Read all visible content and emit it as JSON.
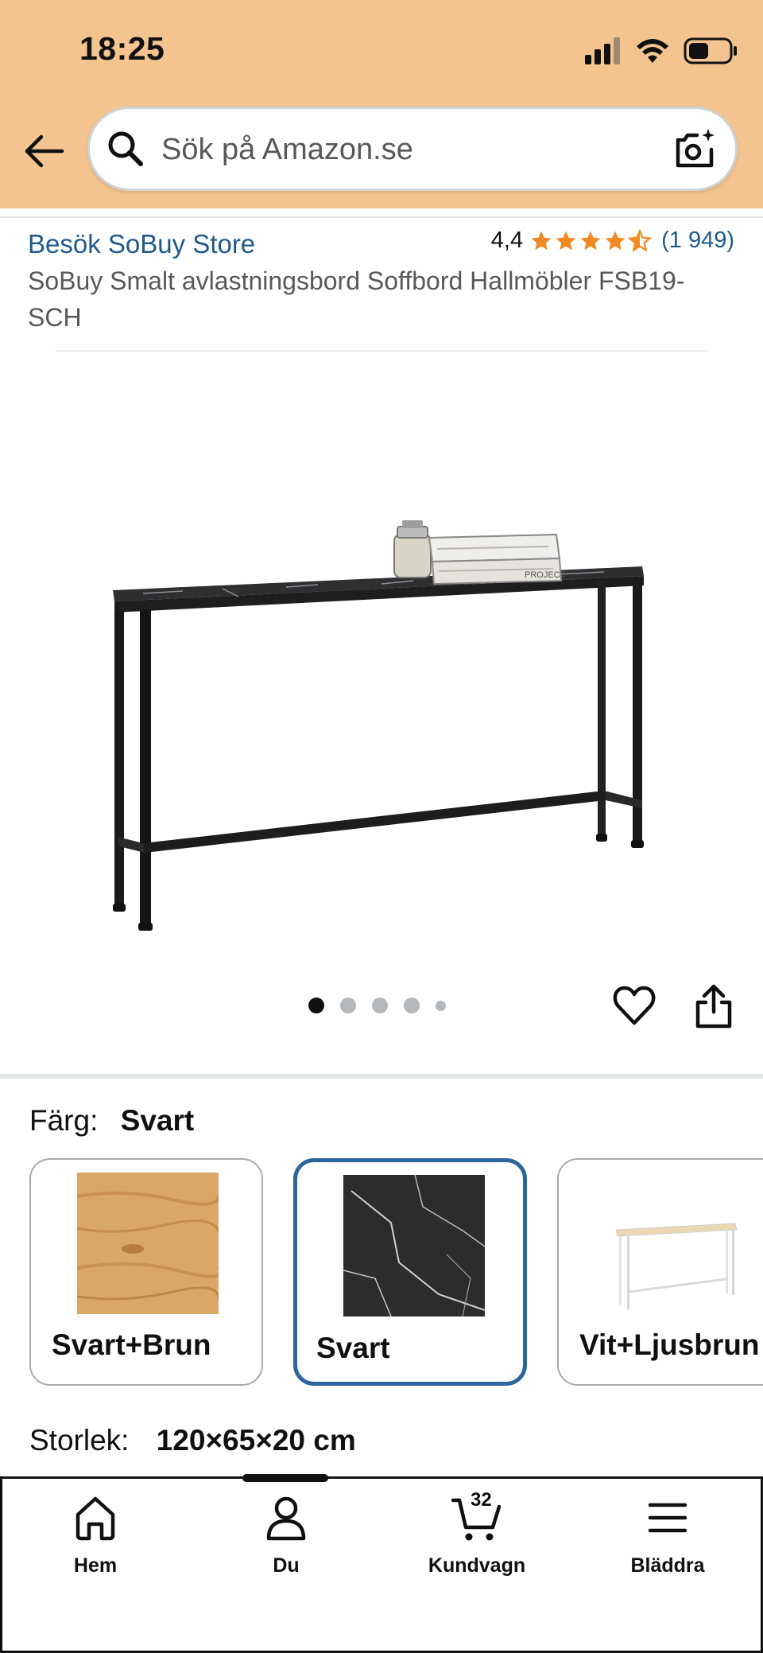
{
  "status_bar": {
    "time": "18:25"
  },
  "search": {
    "placeholder": "Sök på Amazon.se"
  },
  "product": {
    "store_link": "Besök SoBuy Store",
    "rating": "4,4",
    "stars": 4.4,
    "review_count": "(1 949)",
    "title": "SoBuy Smalt avlastningsbord Soffbord Hallmöbler FSB19-SCH",
    "image_count": 5,
    "current_image": 1
  },
  "variants": {
    "color_label": "Färg:",
    "color_value": "Svart",
    "colors": [
      {
        "label": "Svart+Brun",
        "selected": false
      },
      {
        "label": "Svart",
        "selected": true
      },
      {
        "label": "Vit+Ljusbrun",
        "selected": false
      }
    ],
    "size_label": "Storlek:",
    "size_value": "120×65×20 cm"
  },
  "bottom_nav": {
    "items": [
      {
        "label": "Hem",
        "icon": "home-icon"
      },
      {
        "label": "Du",
        "icon": "user-icon"
      },
      {
        "label": "Kundvagn",
        "icon": "cart-icon",
        "badge": "32"
      },
      {
        "label": "Bläddra",
        "icon": "menu-icon"
      }
    ]
  },
  "colors": {
    "header_bg": "#f3c48f",
    "link": "#1f5a8a",
    "star": "#f08a24",
    "selected_border": "#2b669e"
  }
}
